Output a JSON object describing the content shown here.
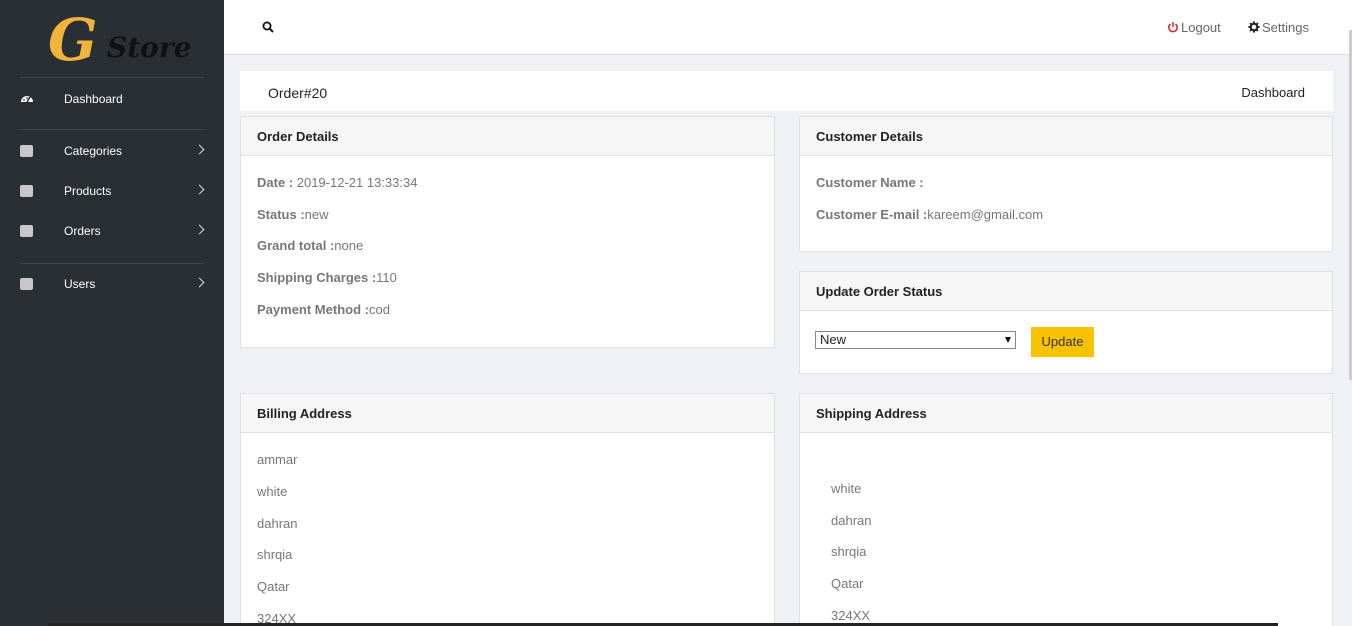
{
  "brand": {
    "letter": "G",
    "name": "Store",
    "accent": "#f0b43c"
  },
  "sidebar": {
    "items": [
      {
        "label": "Dashboard",
        "icon": "dashboard-icon",
        "has_chevron": false
      },
      {
        "label": "Categories",
        "icon": "square-icon",
        "has_chevron": true
      },
      {
        "label": "Products",
        "icon": "square-icon",
        "has_chevron": true
      },
      {
        "label": "Orders",
        "icon": "square-icon",
        "has_chevron": true
      },
      {
        "label": "Users",
        "icon": "square-icon",
        "has_chevron": true
      }
    ]
  },
  "topbar": {
    "search_icon": "search-icon",
    "logout_label": "Logout",
    "settings_label": "Settings"
  },
  "page": {
    "title": "Order#20",
    "breadcrumb": "Dashboard"
  },
  "order_details": {
    "heading": "Order Details",
    "rows": [
      {
        "label": "Date : ",
        "value": "2019-12-21 13:33:34"
      },
      {
        "label": "Status :",
        "value": "new"
      },
      {
        "label": "Grand total :",
        "value": "none"
      },
      {
        "label": "Shipping Charges :",
        "value": "110"
      },
      {
        "label": "Payment Method :",
        "value": "cod"
      }
    ]
  },
  "customer_details": {
    "heading": "Customer Details",
    "rows": [
      {
        "label": "Customer Name :",
        "value": ""
      },
      {
        "label": "Customer E-mail :",
        "value": "kareem@gmail.com"
      }
    ]
  },
  "update_status": {
    "heading": "Update Order Status",
    "selected": "New",
    "button_label": "Update",
    "button_color": "#f8c200"
  },
  "billing_address": {
    "heading": "Billing Address",
    "lines": [
      "ammar",
      "white",
      "dahran",
      "shrqia",
      "Qatar",
      "324XX"
    ]
  },
  "shipping_address": {
    "heading": "Shipping Address",
    "lines": [
      "white",
      "dahran",
      "shrqia",
      "Qatar",
      "324XX"
    ]
  }
}
